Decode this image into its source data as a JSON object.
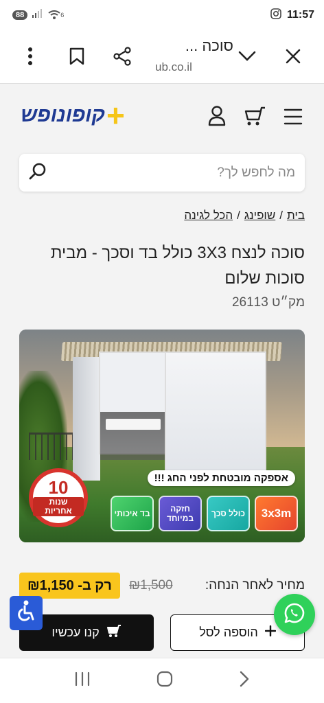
{
  "status_bar": {
    "battery": "88",
    "network": "6",
    "time": "11:57"
  },
  "browser": {
    "title": "סוכה ...",
    "url": "ub.co.il"
  },
  "site": {
    "logo_text": "קופונופש",
    "logo_plus": "+"
  },
  "search": {
    "placeholder": "מה לחפש לך?"
  },
  "breadcrumb": {
    "items": [
      "בית",
      "שופינג",
      "הכל לגינה"
    ],
    "separator": "/"
  },
  "product": {
    "title": "סוכה לנצח 3X3 כולל בד וסכך - מבית סוכות שלום",
    "sku": "מק״ט 26113",
    "image": {
      "ribbon": "אספקה מובטחת לפני החג !!!",
      "badges": [
        {
          "text": "3x3m",
          "color": "#e6452e"
        },
        {
          "text": "כולל סכך",
          "color": "#17a7a1"
        },
        {
          "text": "חזקה במיוחד",
          "color": "#3e3cb0"
        },
        {
          "text": "בד איכותי",
          "color": "#1ea44a"
        }
      ],
      "warranty_number": "10",
      "warranty_text": "שנות אחריות"
    },
    "price_label": "מחיר לאחר הנחה:",
    "price_old": "₪1,500",
    "price_new": "רק ב- ₪1,150"
  },
  "buttons": {
    "add_to_cart": "הוספה לסל",
    "buy_now": "קנו עכשיו"
  },
  "colors": {
    "accent_yellow": "#f9c51d",
    "whatsapp_green": "#2fd15a",
    "a11y_blue": "#2a5bd7",
    "logo_blue": "#1f3a93"
  }
}
